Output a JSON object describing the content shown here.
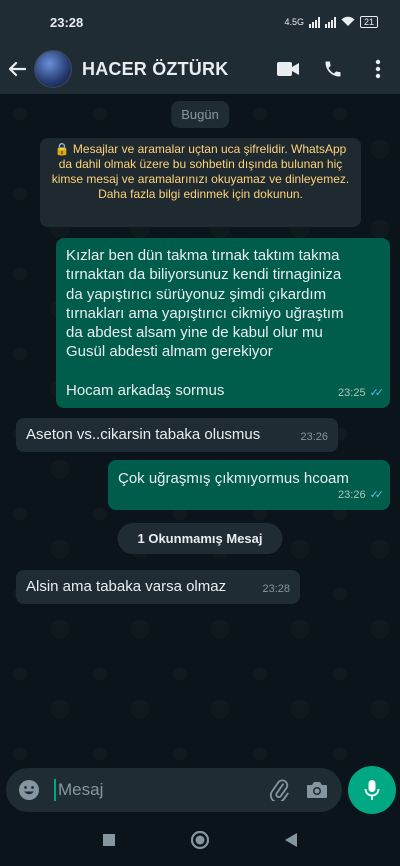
{
  "status_bar": {
    "time": "23:28",
    "network": "4.5G",
    "battery": "21"
  },
  "header": {
    "contact_name": "HACER ÖZTÜRK",
    "icons": [
      "back-arrow-icon",
      "video-call-icon",
      "phone-call-icon",
      "more-options-icon"
    ]
  },
  "chat": {
    "date_label": "Bugün",
    "encryption_notice": "🔒 Mesajlar ve aramalar uçtan uca şifrelidir. WhatsApp da dahil olmak üzere bu sohbetin dışında bulunan hiç kimse mesaj ve aramalarınızı okuyamaz ve dinleyemez. Daha fazla bilgi edinmek için dokunun.",
    "messages": [
      {
        "direction": "outgoing",
        "lines": [
          "Kızlar ben dün takma tırnak taktım takma",
          "tırnaktan da biliyorsunuz kendi tirnaginiza",
          "da yapıştırıcı sürüyonuz şimdi çıkardım",
          "tırnakları ama yapıştırıcı cikmiyo uğraştım",
          "da abdest alsam yine de kabul olur mu",
          "Gusül abdesti almam  gerekiyor",
          "",
          "Hocam arkadaş sormus"
        ],
        "time": "23:25",
        "read": true
      },
      {
        "direction": "incoming",
        "text": "Aseton vs..cikarsin tabaka olusmus",
        "time": "23:26"
      },
      {
        "direction": "outgoing",
        "text": "Çok uğraşmış çıkmıyormus hcoam",
        "time": "23:26",
        "read": true
      },
      {
        "direction": "incoming",
        "text": "Alsin ama tabaka varsa olmaz",
        "time": "23:28"
      }
    ],
    "unread_label": "1 Okunmamış Mesaj"
  },
  "composer": {
    "placeholder": "Mesaj",
    "icons": [
      "emoji-icon",
      "attach-icon",
      "camera-icon",
      "microphone-icon"
    ]
  },
  "colors": {
    "outgoing_bubble": "#005c4b",
    "incoming_bubble": "#1f2c34",
    "accent": "#00a884",
    "read_ticks": "#53bdeb",
    "encryption_text": "#ffd279"
  }
}
